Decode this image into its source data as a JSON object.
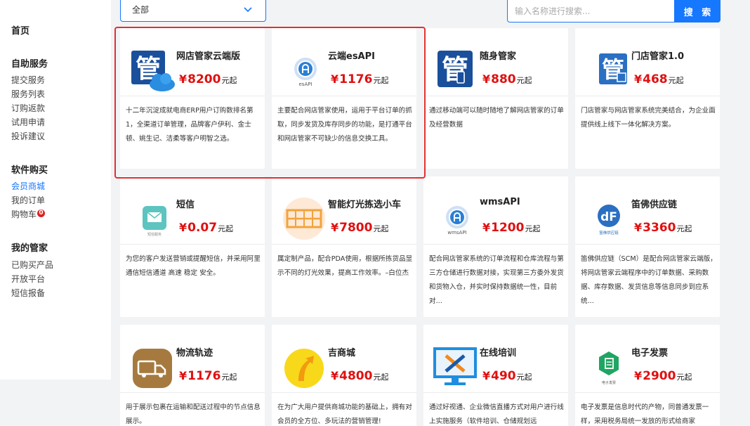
{
  "sidebar": {
    "home": "首页",
    "groups": [
      {
        "title": "自助服务",
        "items": [
          "提交服务",
          "服务列表",
          "订购返款",
          "试用申请",
          "投诉建议"
        ]
      },
      {
        "title": "软件购买",
        "items": [
          "会员商城",
          "我的订单",
          "购物车"
        ]
      },
      {
        "title": "我的管家",
        "items": [
          "已购买产品",
          "开放平台",
          "短信报备"
        ]
      }
    ],
    "cart_badge": "0"
  },
  "filter": {
    "selected": "全部"
  },
  "search": {
    "placeholder": "输入名称进行搜索...",
    "button": "搜 索"
  },
  "price_suffix": "元起",
  "currency": "¥",
  "colors": {
    "accent": "#1677ff",
    "price": "#e01010",
    "highlight": "#e23030"
  },
  "products": [
    {
      "title": "网店管家云端版",
      "price": "8200",
      "icon": "cloud-manager-icon",
      "desc": "十二年沉淀成就电商ERP用户订购数排名第1，全渠道订单管理，品牌客户伊利、金士顿、姚生记、洁柔等客户明智之选。"
    },
    {
      "title": "云端esAPI",
      "price": "1176",
      "icon": "esapi-icon",
      "desc": "主要配合网店管家使用，运用于平台订单的抓取，同步发货及库存同步的功能，是打通平台和网店管家不可缺少的信息交换工具。"
    },
    {
      "title": "随身管家",
      "price": "880",
      "icon": "mobile-manager-icon",
      "desc": "通过移动端可以随时随地了解网店管家的订单及经营数据"
    },
    {
      "title": "门店管家1.0",
      "price": "468",
      "icon": "store-manager-icon",
      "desc": "门店管家与网店管家系统完美结合，为企业面提供线上线下一体化解决方案。"
    },
    {
      "title": "短信",
      "price": "0.07",
      "icon": "sms-icon",
      "desc": "为您的客户发送营销或提醒短信，并采用阿里通信短信通道 高速 稳定 安全。"
    },
    {
      "title": "智能灯光拣选小车",
      "price": "7800",
      "icon": "picking-cart-icon",
      "desc": "属定制产品，配合PDA使用，根据所拣货品显示不同的灯光效果，提高工作效率。–白位杰"
    },
    {
      "title": "wmsAPI",
      "price": "1200",
      "icon": "wmsapi-icon",
      "desc": "配合网店管家系统的订单流程和仓库流程与第三方仓储进行数据对接，实现第三方委外发货和货物入仓，并实时保持数据统一性，目前对..."
    },
    {
      "title": "笛佛供应链",
      "price": "3360",
      "icon": "supply-chain-icon",
      "desc": "笛佛供应链（SCM）是配合网店管家云端版，将网店管家云端程序中的订单数据、采购数据、库存数据、发货信息等信息同步到应系统..."
    },
    {
      "title": "物流轨迹",
      "price": "1176",
      "icon": "logistics-icon",
      "desc": "用于展示包裹在运输和配送过程中的节点信息展示。"
    },
    {
      "title": "吉商城",
      "price": "4800",
      "icon": "mall-icon",
      "desc": "在为广大用户提供商城功能的基础上，拥有对会员的全方位、多玩法的营销管理!"
    },
    {
      "title": "在线培训",
      "price": "490",
      "icon": "training-icon",
      "desc": "通过好视通、企业微信直播方式对用户进行线上实施服务（软件培训、仓储规划远"
    },
    {
      "title": "电子发票",
      "price": "2900",
      "icon": "invoice-icon",
      "desc": "电子发票是信息时代的产物，同普通发票一样，采用税务局统一发放的形式给商家"
    }
  ],
  "icon_labels": {
    "esapi": "esAPI",
    "sms": "短信服务",
    "wmsapi": "wmsAPI",
    "supply": "笛佛供应链",
    "invoice": "电子发票"
  }
}
